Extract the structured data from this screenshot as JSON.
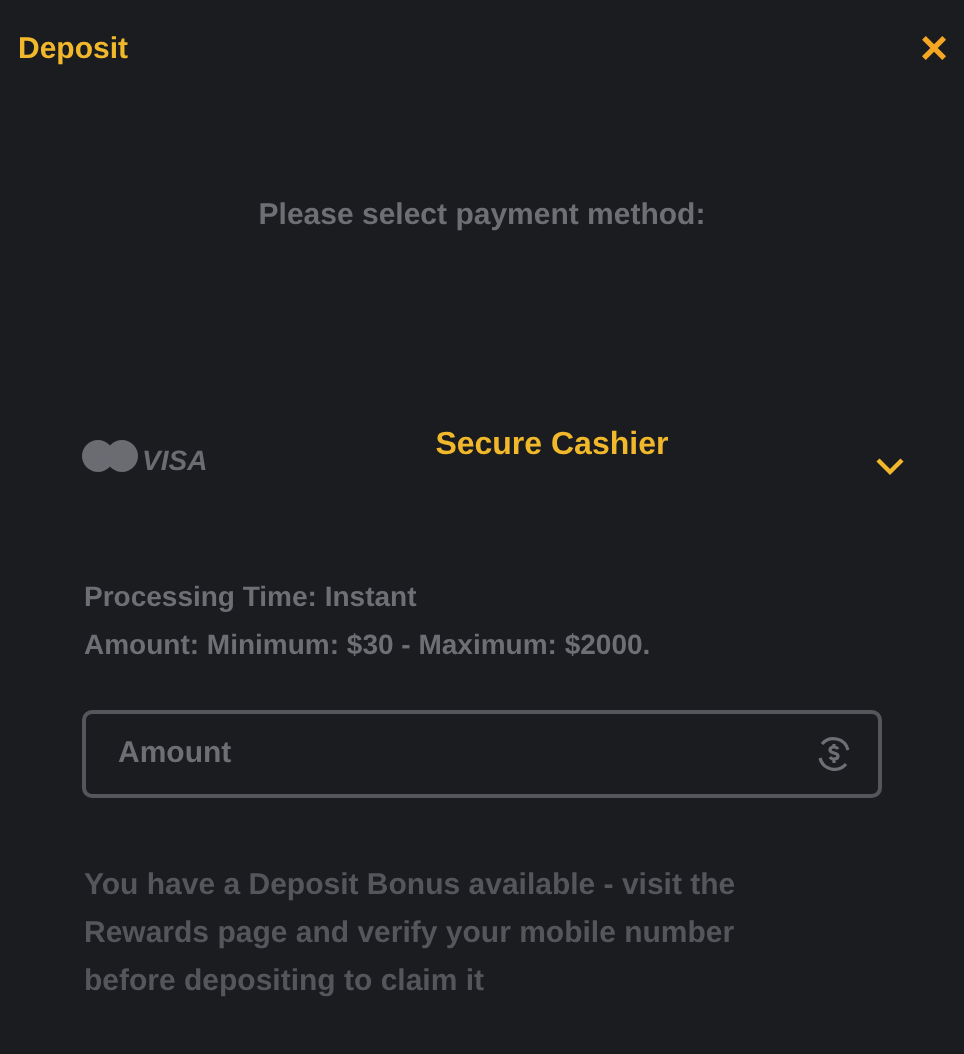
{
  "window": {
    "title": "Deposit",
    "close": "×"
  },
  "prompt": "Please select payment method:",
  "method": {
    "logo_text": "VISA",
    "label": "Secure Cashier"
  },
  "info": [
    "Processing Time: Instant",
    "Amount: Minimum: $30 - Maximum: $2000."
  ],
  "amount_field": {
    "placeholder": "Amount"
  },
  "notice": "You have a Deposit Bonus available - visit the Rewards page and verify your mobile number before depositing to claim it"
}
